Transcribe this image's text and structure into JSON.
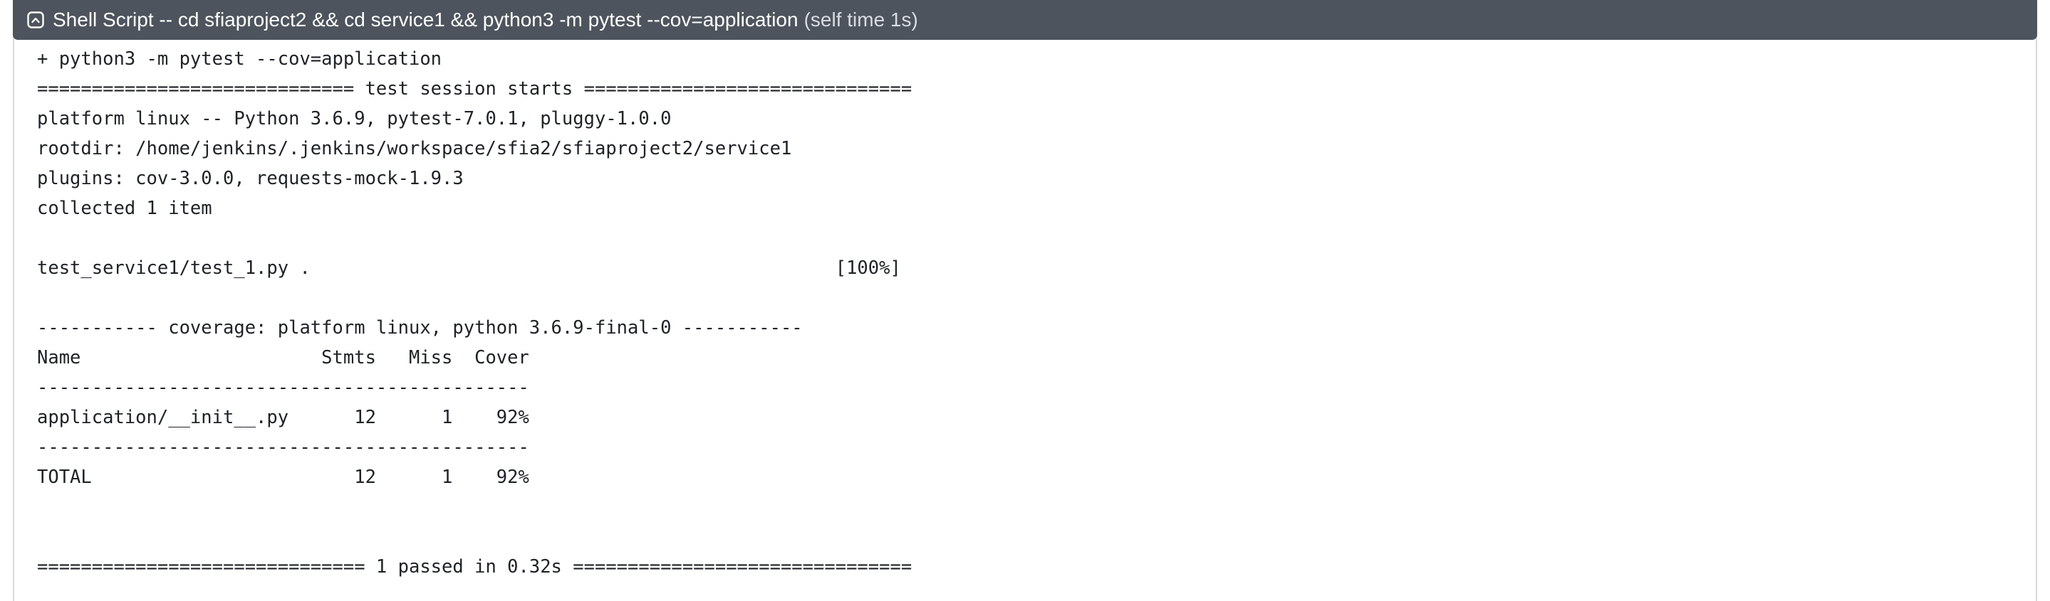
{
  "step": {
    "icon": "terminal-icon",
    "title": "Shell Script -- cd sfiaproject2 && cd service1 && python3 -m pytest --cov=application",
    "self_time": "(self time 1s)"
  },
  "log_lines": [
    "+ python3 -m pytest --cov=application",
    "============================= test session starts ==============================",
    "platform linux -- Python 3.6.9, pytest-7.0.1, pluggy-1.0.0",
    "rootdir: /home/jenkins/.jenkins/workspace/sfia2/sfiaproject2/service1",
    "plugins: cov-3.0.0, requests-mock-1.9.3",
    "collected 1 item",
    "",
    "test_service1/test_1.py .                                                [100%]",
    "",
    "----------- coverage: platform linux, python 3.6.9-final-0 -----------",
    "Name                      Stmts   Miss  Cover",
    "---------------------------------------------",
    "application/__init__.py      12      1    92%",
    "---------------------------------------------",
    "TOTAL                        12      1    92%",
    "",
    "",
    "============================== 1 passed in 0.32s ==============================="
  ]
}
